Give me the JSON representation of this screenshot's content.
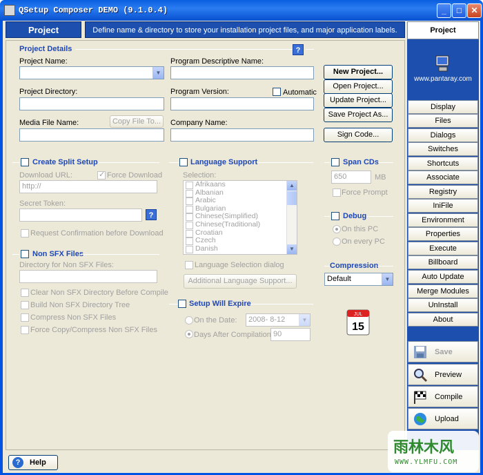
{
  "window": {
    "title": "QSetup Composer DEMO (9.1.0.4)"
  },
  "header": {
    "title": "Project",
    "description": "Define name & directory to store your installation project files, and major application labels."
  },
  "project_details": {
    "section": "Project Details",
    "help": "?",
    "project_name_label": "Project Name:",
    "program_desc_label": "Program Descriptive Name:",
    "project_dir_label": "Project Directory:",
    "program_version_label": "Program Version:",
    "automatic_label": "Automatic",
    "media_file_label": "Media File Name:",
    "copy_file_label": "Copy File To...",
    "company_name_label": "Company Name:"
  },
  "project_buttons": {
    "new": "New Project...",
    "open": "Open Project...",
    "update": "Update Project...",
    "save_as": "Save Project As...",
    "sign": "Sign Code..."
  },
  "split_setup": {
    "section": "Create Split Setup",
    "download_url_label": "Download URL:",
    "force_download": "Force Download",
    "url_value": "http://",
    "secret_token_label": "Secret Token:",
    "help": "?",
    "request_confirm": "Request Confirmation before Download"
  },
  "non_sfx": {
    "section": "Non SFX Files",
    "dir_label": "Directory for Non SFX Files:",
    "options": [
      "Clear Non SFX Directory Before Compile",
      "Build Non SFX Directory Tree",
      "Compress Non SFX Files",
      "Force Copy/Compress Non SFX Files"
    ]
  },
  "language": {
    "section": "Language Support",
    "selection_label": "Selection:",
    "languages": [
      "Afrikaans",
      "Albanian",
      "Arabic",
      "Bulgarian",
      "Chinese(Simplified)",
      "Chinese(Traditional)",
      "Croatian",
      "Czech",
      "Danish"
    ],
    "dialog_option": "Language Selection dialog",
    "additional_button": "Additional Language Support..."
  },
  "expire": {
    "section": "Setup Will Expire",
    "on_date_label": "On the Date:",
    "date_value": "2008- 8-12",
    "days_after_label": "Days After Compilation:",
    "days_value": "90"
  },
  "span_cds": {
    "section": "Span CDs",
    "size_value": "650",
    "unit": "MB",
    "force_prompt": "Force Prompt"
  },
  "debug": {
    "section": "Debug",
    "options": [
      "On this PC",
      "On every PC"
    ]
  },
  "compression": {
    "section": "Compression",
    "value": "Default"
  },
  "sidebar": {
    "active": "Project",
    "logo_site": "www.pantaray.com",
    "nav": [
      "Display",
      "Files",
      "Dialogs",
      "Switches",
      "Shortcuts",
      "Associate",
      "Registry",
      "IniFile",
      "Environment",
      "Properties",
      "Execute",
      "Billboard",
      "Auto Update",
      "Merge Modules",
      "UnInstall",
      "About"
    ],
    "actions": {
      "save": "Save",
      "preview": "Preview",
      "compile": "Compile",
      "upload": "Upload"
    }
  },
  "calendar": {
    "day": "15",
    "month": "JUL"
  },
  "status": {
    "help": "Help"
  },
  "watermark": {
    "text": "雨林木风",
    "url": "WWW.YLMFU.COM"
  }
}
